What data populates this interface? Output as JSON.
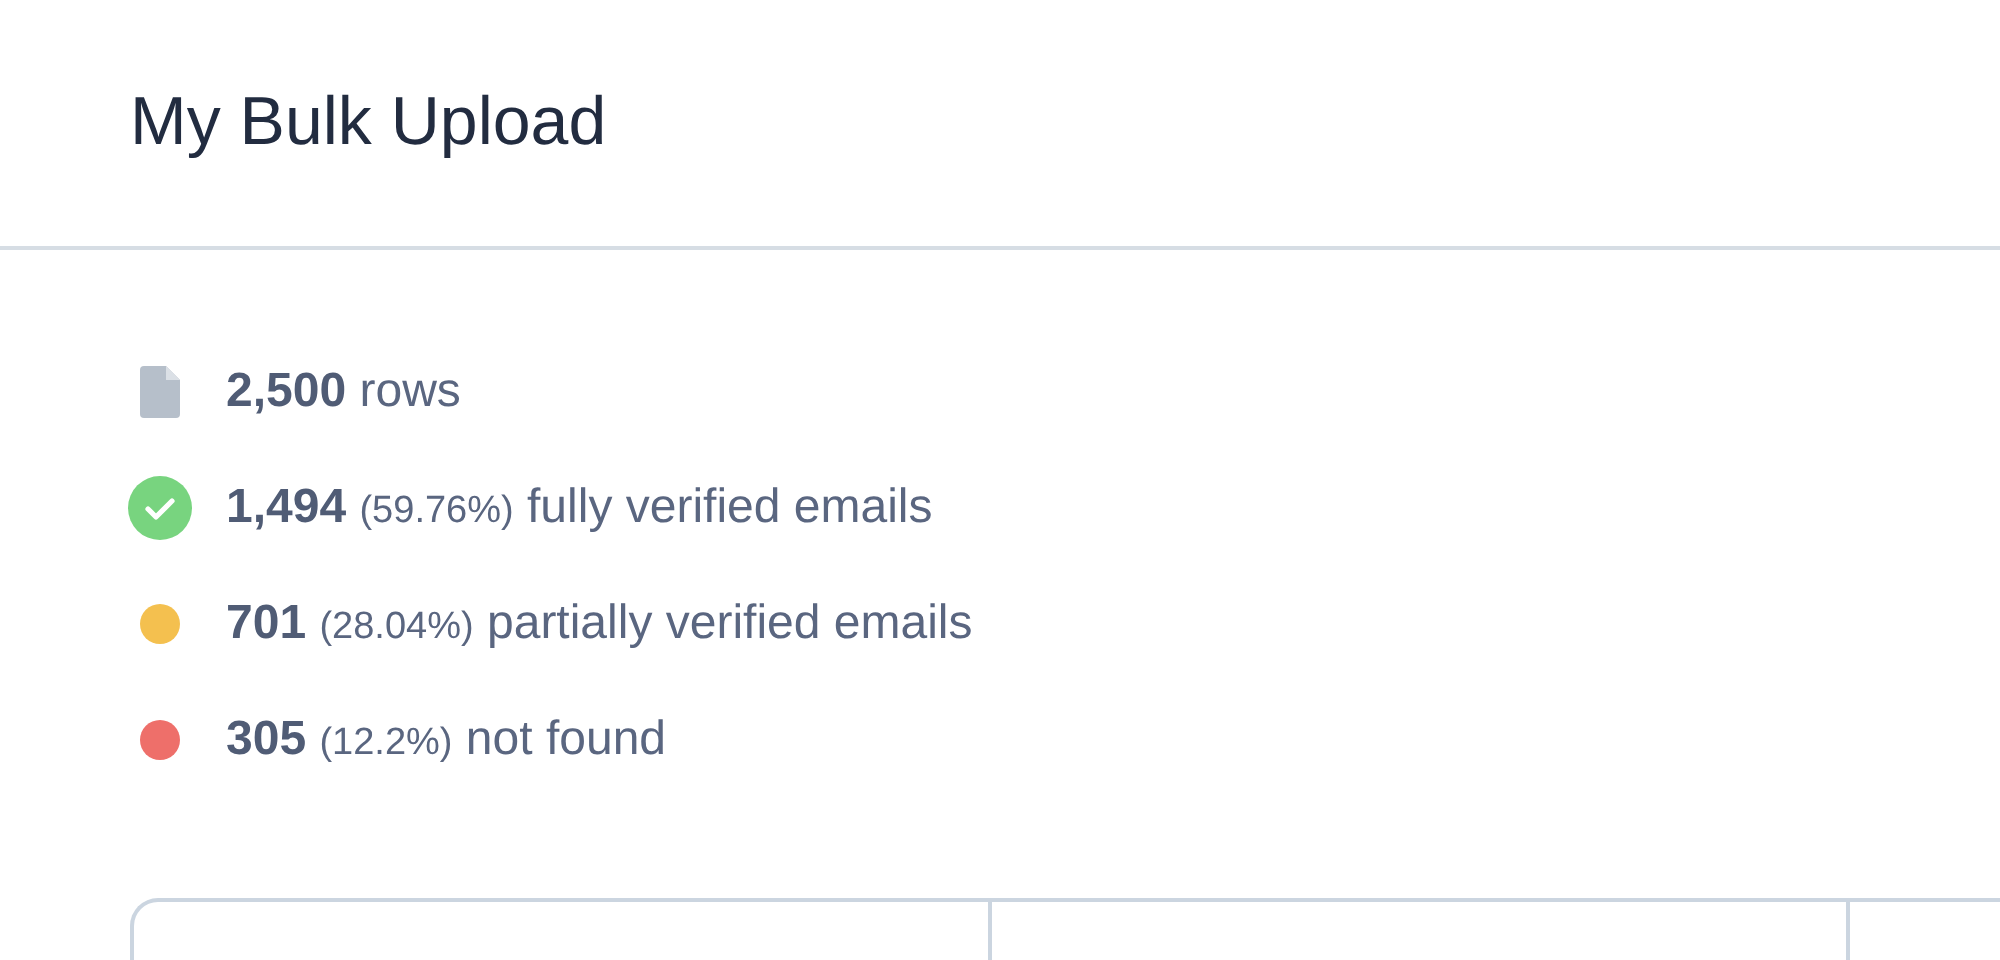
{
  "header": {
    "title": "My Bulk Upload"
  },
  "stats": [
    {
      "kind": "file",
      "count": "2,500",
      "label": "rows"
    },
    {
      "kind": "check",
      "color": "#78d47f",
      "count": "1,494",
      "percent": "(59.76%)",
      "label": "fully verified emails"
    },
    {
      "kind": "dot",
      "color": "#f4c04f",
      "count": "701",
      "percent": "(28.04%)",
      "label": "partially verified emails"
    },
    {
      "kind": "dot",
      "color": "#ee6f6a",
      "count": "305",
      "percent": "(12.2%)",
      "label": "not found"
    }
  ]
}
